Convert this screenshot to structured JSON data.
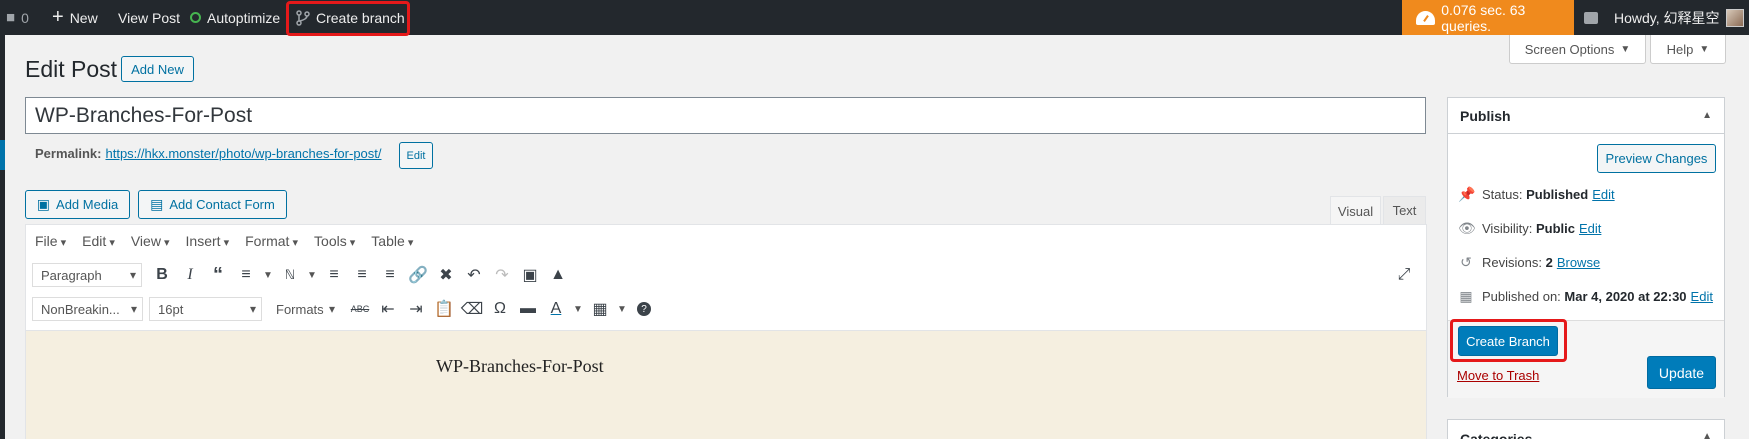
{
  "adminbar": {
    "comments_count": "0",
    "new_label": "New",
    "view_post_label": "View Post",
    "autoptimize_label": "Autoptimize",
    "create_branch_label": "Create branch",
    "speed_label": "0.076 sec. 63 queries.",
    "howdy_label": "Howdy, 幻释星空"
  },
  "header": {
    "screen_options_label": "Screen Options",
    "help_label": "Help",
    "page_title": "Edit Post",
    "add_new_label": "Add New"
  },
  "post": {
    "title": "WP-Branches-For-Post",
    "permalink_label": "Permalink:",
    "permalink_url": "https://hkx.monster/photo/wp-branches-for-post/",
    "permalink_edit_label": "Edit"
  },
  "media": {
    "add_media_label": "Add Media",
    "add_contact_form_label": "Add Contact Form"
  },
  "editor": {
    "tabs": [
      "Visual",
      "Text"
    ],
    "menu": [
      "File",
      "Edit",
      "View",
      "Insert",
      "Format",
      "Tools",
      "Table"
    ],
    "block_format": "Paragraph",
    "font_family": "NonBreakin...",
    "font_size": "16pt",
    "formats_label": "Formats",
    "content_text": "WP-Branches-For-Post"
  },
  "publish": {
    "title": "Publish",
    "preview_label": "Preview Changes",
    "status_label": "Status:",
    "status_value": "Published",
    "visibility_label": "Visibility:",
    "visibility_value": "Public",
    "revisions_label": "Revisions:",
    "revisions_value": "2",
    "browse_label": "Browse",
    "published_on_label": "Published on:",
    "published_on_value": "Mar 4, 2020 at 22:30",
    "edit_label": "Edit",
    "create_branch_label": "Create Branch",
    "move_to_trash_label": "Move to Trash",
    "update_label": "Update"
  },
  "categories": {
    "title": "Categories"
  },
  "colors": {
    "adminbar": "#23282d",
    "speed": "#f08a1d",
    "primary": "#007cba",
    "highlight": "#e5191a"
  }
}
